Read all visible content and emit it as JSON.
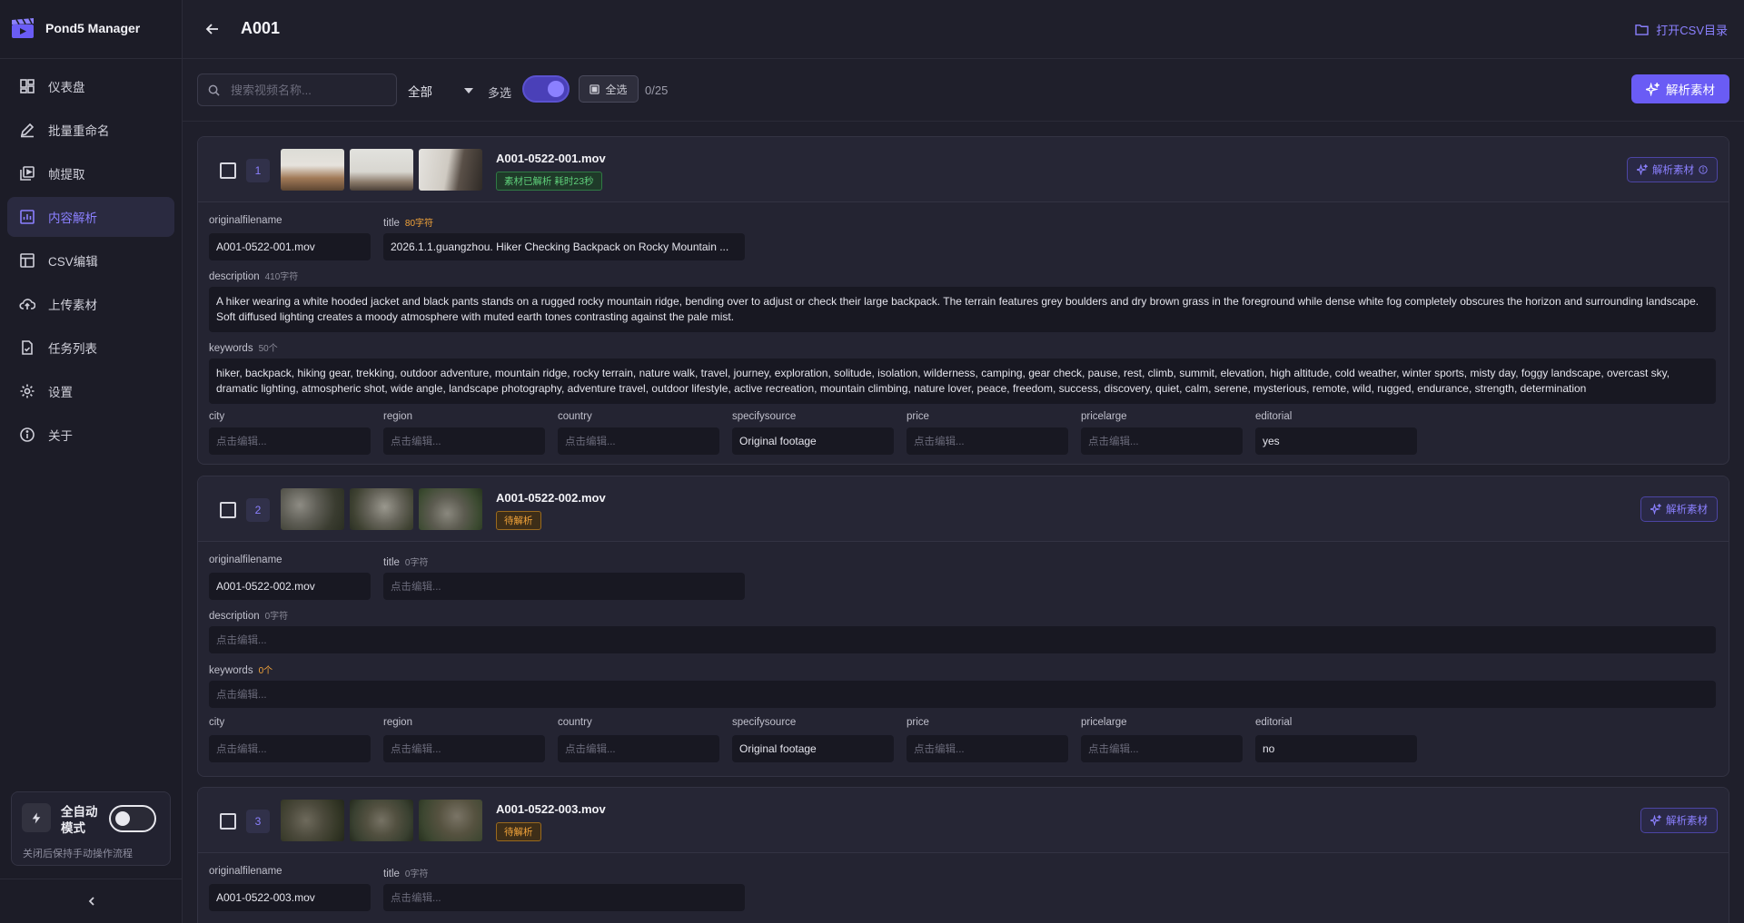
{
  "app": {
    "name": "Pond5 Manager"
  },
  "sidebar": {
    "items": [
      {
        "label": "仪表盘",
        "icon": "dashboard-icon"
      },
      {
        "label": "批量重命名",
        "icon": "pen-icon"
      },
      {
        "label": "帧提取",
        "icon": "frames-icon"
      },
      {
        "label": "内容解析",
        "icon": "analysis-icon",
        "active": true
      },
      {
        "label": "CSV编辑",
        "icon": "table-icon"
      },
      {
        "label": "上传素材",
        "icon": "upload-cloud-icon"
      },
      {
        "label": "任务列表",
        "icon": "task-list-icon"
      },
      {
        "label": "设置",
        "icon": "gear-icon"
      },
      {
        "label": "关于",
        "icon": "info-icon"
      }
    ],
    "auto_mode": {
      "title": "全自动模式",
      "description": "关闭后保持手动操作流程",
      "enabled": false
    }
  },
  "header": {
    "title": "A001",
    "open_csv_label": "打开CSV目录"
  },
  "toolbar": {
    "search_placeholder": "搜索视频名称...",
    "filter_value": "全部",
    "multi_label": "多选",
    "multi_enabled": true,
    "select_all_label": "全选",
    "count": "0/25",
    "analyze_label": "解析素材"
  },
  "colors": {
    "accent": "#6a5cf5",
    "accent_text": "#8b80ff",
    "success": "#5fd07b",
    "warning": "#f3a43a"
  },
  "placeholder_edit": "点击编辑...",
  "cards": [
    {
      "index": "1",
      "filename": "A001-0522-001.mov",
      "status": "素材已解析 耗时23秒",
      "status_type": "done",
      "analyze_label": "解析素材",
      "fields": {
        "originalfilename_label": "originalfilename",
        "originalfilename": "A001-0522-001.mov",
        "title_label": "title",
        "title_hint": "80字符",
        "title": "2026.1.1.guangzhou. Hiker Checking Backpack on Rocky Mountain ...",
        "description_label": "description",
        "description_hint": "410字符",
        "description": "A hiker wearing a white hooded jacket and black pants stands on a rugged rocky mountain ridge, bending over to adjust or check their large backpack. The terrain features grey boulders and dry brown grass in the foreground while dense white fog completely obscures the horizon and surrounding landscape. Soft diffused lighting creates a moody atmosphere with muted earth tones contrasting against the pale mist.",
        "keywords_label": "keywords",
        "keywords_hint": "50个",
        "keywords": "hiker, backpack, hiking gear, trekking, outdoor adventure, mountain ridge, rocky terrain, nature walk, travel, journey, exploration, solitude, isolation, wilderness, camping, gear check, pause, rest, climb, summit, elevation, high altitude, cold weather, winter sports, misty day, foggy landscape, overcast sky, dramatic lighting, atmospheric shot, wide angle, landscape photography, adventure travel, outdoor lifestyle, active recreation, mountain climbing, nature lover, peace, freedom, success, discovery, quiet, calm, serene, mysterious, remote, wild, rugged, endurance, strength, determination",
        "city_label": "city",
        "city": "",
        "region_label": "region",
        "region": "",
        "country_label": "country",
        "country": "",
        "specifysource_label": "specifysource",
        "specifysource": "Original footage",
        "price_label": "price",
        "price": "",
        "pricelarge_label": "pricelarge",
        "pricelarge": "",
        "editorial_label": "editorial",
        "editorial": "yes"
      }
    },
    {
      "index": "2",
      "filename": "A001-0522-002.mov",
      "status": "待解析",
      "status_type": "pending",
      "analyze_label": "解析素材",
      "fields": {
        "originalfilename_label": "originalfilename",
        "originalfilename": "A001-0522-002.mov",
        "title_label": "title",
        "title_hint": "0字符",
        "title": "",
        "description_label": "description",
        "description_hint": "0字符",
        "description": "",
        "keywords_label": "keywords",
        "keywords_hint": "0个",
        "keywords": "",
        "city_label": "city",
        "city": "",
        "region_label": "region",
        "region": "",
        "country_label": "country",
        "country": "",
        "specifysource_label": "specifysource",
        "specifysource": "Original footage",
        "price_label": "price",
        "price": "",
        "pricelarge_label": "pricelarge",
        "pricelarge": "",
        "editorial_label": "editorial",
        "editorial": "no"
      }
    },
    {
      "index": "3",
      "filename": "A001-0522-003.mov",
      "status": "待解析",
      "status_type": "pending",
      "analyze_label": "解析素材",
      "fields": {
        "originalfilename_label": "originalfilename",
        "originalfilename": "A001-0522-003.mov",
        "title_label": "title",
        "title_hint": "0字符",
        "title": ""
      }
    }
  ]
}
